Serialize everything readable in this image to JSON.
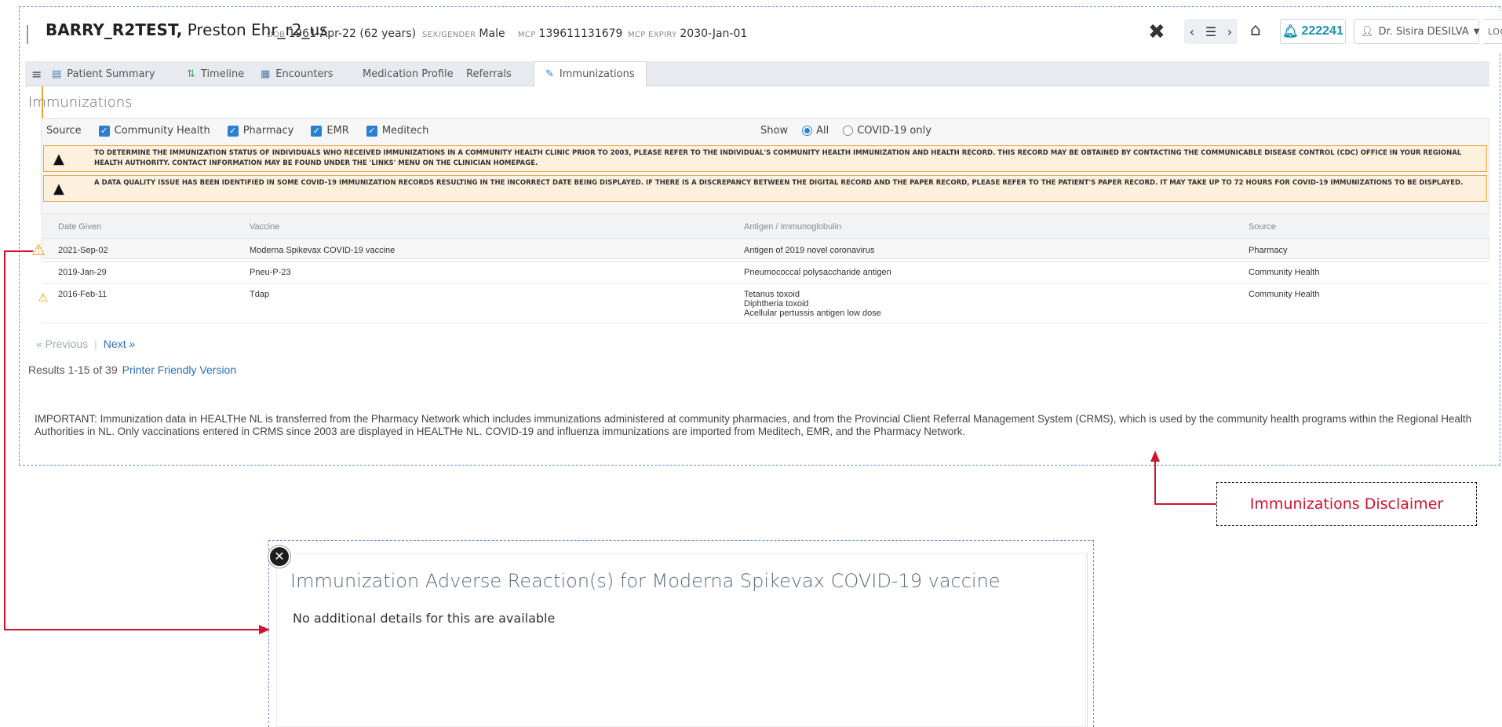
{
  "patient": {
    "last_name": "BARRY_R2TEST,",
    "first_name": "Preston Ehr_r2_us",
    "dob_label": "DOB",
    "dob": "1961-Apr-22 (62 years)",
    "sex_label": "SEX/GENDER",
    "sex": "Male",
    "mcp_label": "MCP",
    "mcp": "139611131679",
    "mcp_expiry_label": "MCP EXPIRY",
    "mcp_expiry": "2030-Jan-01"
  },
  "header": {
    "notification_count": "222241",
    "user_name": "Dr. Sisira DESILVA",
    "logout_label": "LOGO"
  },
  "tabs": [
    {
      "label": "Patient Summary",
      "icon": "summary-icon"
    },
    {
      "label": "Timeline",
      "icon": "timeline-icon"
    },
    {
      "label": "Encounters",
      "icon": "encounters-icon"
    },
    {
      "label": "Medication Profile",
      "icon": ""
    },
    {
      "label": "Referrals",
      "icon": ""
    },
    {
      "label": "Immunizations",
      "icon": "syringe-icon",
      "active": true
    }
  ],
  "page_title": "Immunizations",
  "filters": {
    "source_label": "Source",
    "sources": [
      "Community Health",
      "Pharmacy",
      "EMR",
      "Meditech"
    ],
    "show_label": "Show",
    "show_options": [
      "All",
      "COVID-19 only"
    ],
    "show_selected": "All"
  },
  "alerts": [
    "To determine the immunization status of individuals who received immunizations in a community health clinic prior to 2003, please refer to the individual's community health immunization and health record. This record may be obtained by contacting the communicable disease control (CDC) office in your regional health authority. Contact information may be found under the 'Links' menu on the clinician homepage.",
    "A data quality issue has been identified in some COVID-19 immunization records resulting in the incorrect date being displayed. If there is a discrepancy between the digital record and the paper record, please refer to the patient's paper record. It may take up to 72 hours for COVID-19 immunizations to be displayed."
  ],
  "table": {
    "headers": [
      "Date Given",
      "Vaccine",
      "Antigen / Immunoglobulin",
      "Source"
    ],
    "rows": [
      {
        "date": "2021-Sep-02",
        "vaccine": "Moderna Spikevax COVID-19 vaccine",
        "antigen": [
          "Antigen of 2019 novel coronavirus"
        ],
        "source": "Pharmacy",
        "warning": true
      },
      {
        "date": "2019-Jan-29",
        "vaccine": "Pneu-P-23",
        "antigen": [
          "Pneumococcal polysaccharide antigen"
        ],
        "source": "Community Health",
        "warning": false
      },
      {
        "date": "2016-Feb-11",
        "vaccine": "Tdap",
        "antigen": [
          "Tetanus toxoid",
          "Diphtheria toxoid",
          "Acellular pertussis antigen low dose"
        ],
        "source": "Community Health",
        "warning": true
      }
    ]
  },
  "pager": {
    "previous": "« Previous",
    "next": "Next »"
  },
  "results": {
    "summary": "Results 1-15 of 39",
    "printer_link": "Printer Friendly Version"
  },
  "disclaimer": "IMPORTANT: Immunization data in HEALTHe NL is transferred from the Pharmacy Network which includes immunizations administered at community pharmacies, and from the Provincial Client Referral Management System (CRMS), which is used by the community health programs within the Regional Health Authorities in NL. Only vaccinations entered in CRMS since 2003 are displayed in HEALTHe NL. COVID-19 and influenza immunizations are imported from Meditech, EMR, and the Pharmacy Network.",
  "callout": "Immunizations Disclaimer",
  "modal": {
    "title": "Immunization Adverse Reaction(s) for Moderna Spikevax COVID-19 vaccine",
    "body": "No additional details for this are available"
  },
  "colors": {
    "accent": "#2a7fd4",
    "warning": "#e3a21a",
    "callout_red": "#d2122e",
    "alert_bg": "#fdf1de"
  }
}
